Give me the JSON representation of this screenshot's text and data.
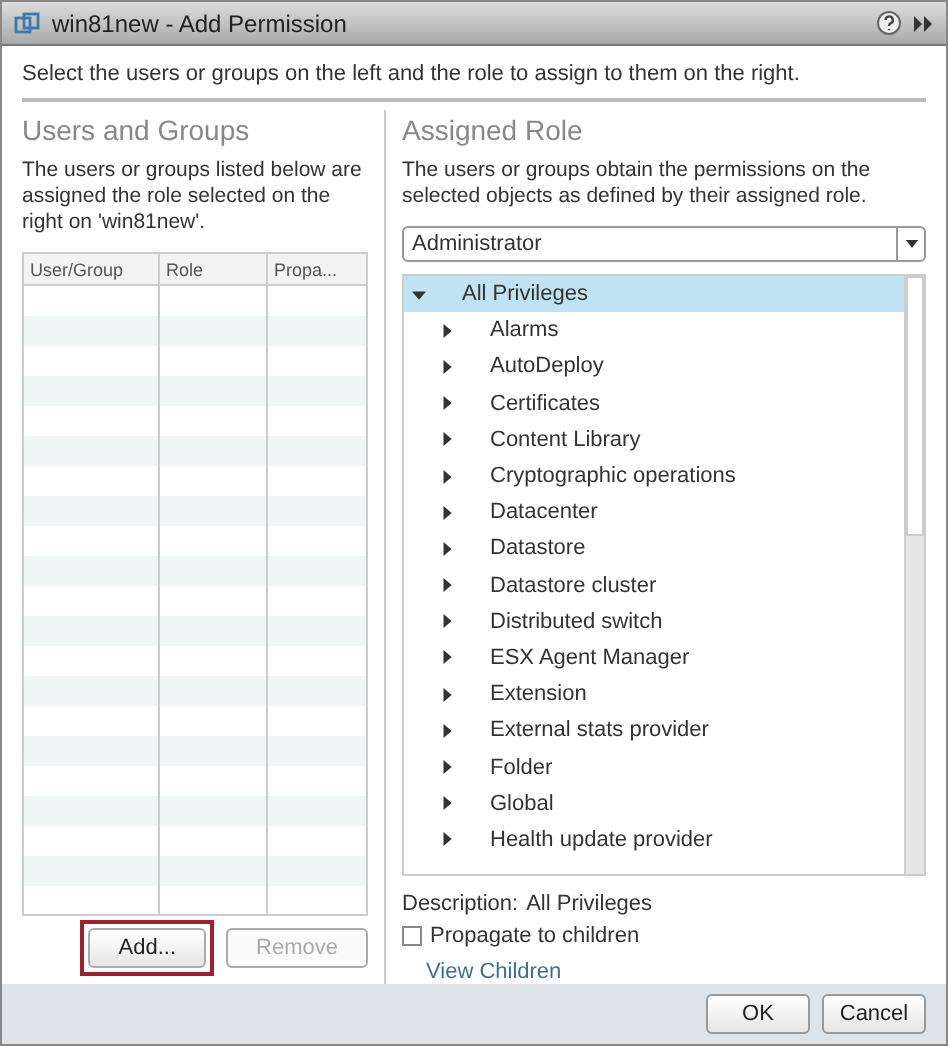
{
  "window": {
    "title": "win81new - Add Permission"
  },
  "instruction": "Select the users or groups on the left and the role to assign to them on the right.",
  "users_and_groups": {
    "heading": "Users and Groups",
    "description": "The users or groups listed below are assigned the role selected on the right on 'win81new'.",
    "columns": [
      "User/Group",
      "Role",
      "Propa..."
    ],
    "buttons": [
      {
        "label": "Add...",
        "disabled": false,
        "highlighted": true
      },
      {
        "label": "Remove",
        "disabled": true,
        "highlighted": false
      }
    ]
  },
  "assigned_role": {
    "heading": "Assigned Role",
    "description": "The users or groups obtain the permissions on the selected objects as defined by their assigned role.",
    "role_select": {
      "value": "Administrator"
    },
    "privileges": [
      {
        "label": "All Privileges",
        "expanded": true,
        "selected": true,
        "children": [
          {
            "label": "Alarms",
            "expanded": false,
            "selected": false
          },
          {
            "label": "AutoDeploy",
            "expanded": false,
            "selected": false
          },
          {
            "label": "Certificates",
            "expanded": false,
            "selected": false
          },
          {
            "label": "Content Library",
            "expanded": false,
            "selected": false
          },
          {
            "label": "Cryptographic operations",
            "expanded": false,
            "selected": false
          },
          {
            "label": "Datacenter",
            "expanded": false,
            "selected": false
          },
          {
            "label": "Datastore",
            "expanded": false,
            "selected": false
          },
          {
            "label": "Datastore cluster",
            "expanded": false,
            "selected": false
          },
          {
            "label": "Distributed switch",
            "expanded": false,
            "selected": false
          },
          {
            "label": "ESX Agent Manager",
            "expanded": false,
            "selected": false
          },
          {
            "label": "Extension",
            "expanded": false,
            "selected": false
          },
          {
            "label": "External stats provider",
            "expanded": false,
            "selected": false
          },
          {
            "label": "Folder",
            "expanded": false,
            "selected": false
          },
          {
            "label": "Global",
            "expanded": false,
            "selected": false
          },
          {
            "label": "Health update provider",
            "expanded": false,
            "selected": false
          }
        ]
      }
    ],
    "description_label": "Description:",
    "description_value": "All Privileges",
    "propagate": {
      "label": "Propagate to children",
      "checked": false
    },
    "view_children_link": "View Children"
  },
  "footer_buttons": [
    "OK",
    "Cancel"
  ]
}
